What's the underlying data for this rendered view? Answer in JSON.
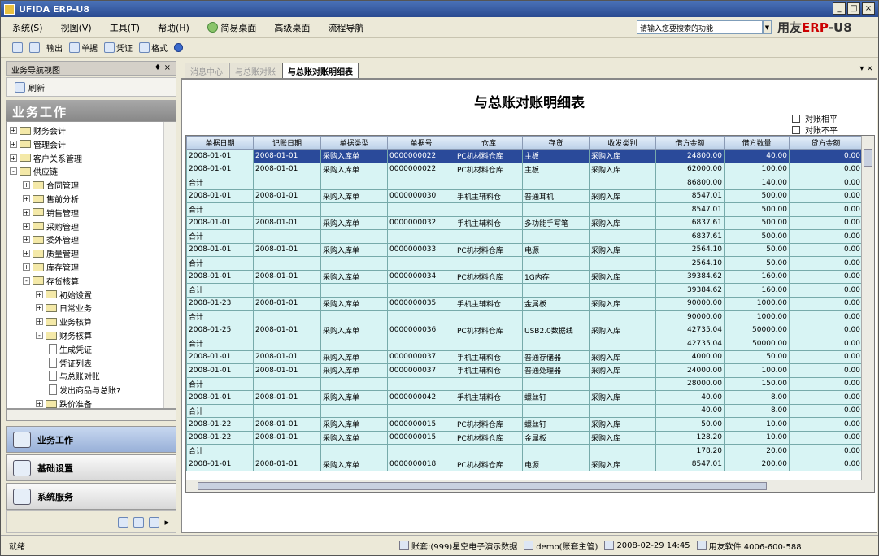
{
  "window": {
    "title": "UFIDA ERP-U8",
    "controls": [
      "_",
      "□",
      "×"
    ]
  },
  "menu": [
    "系统(S)",
    "视图(V)",
    "工具(T)",
    "帮助(H)",
    "简易桌面",
    "高级桌面",
    "流程导航"
  ],
  "search": {
    "placeholder": "请输入您要搜索的功能"
  },
  "brand": {
    "prefix": "用友",
    "erp": "ERP",
    "suffix": "-U8"
  },
  "toolbar": [
    "",
    "",
    "输出",
    "单据",
    "凭证",
    "格式",
    ""
  ],
  "nav": {
    "header": "业务导航视图",
    "pin": "♦ ×",
    "refresh": "刷新",
    "section": "业务工作",
    "tree": [
      {
        "label": "财务会计",
        "level": 0,
        "state": "+",
        "kind": "folder"
      },
      {
        "label": "管理会计",
        "level": 0,
        "state": "+",
        "kind": "folder"
      },
      {
        "label": "客户关系管理",
        "level": 0,
        "state": "+",
        "kind": "folder"
      },
      {
        "label": "供应链",
        "level": 0,
        "state": "-",
        "kind": "folder"
      },
      {
        "label": "合同管理",
        "level": 1,
        "state": "+",
        "kind": "folder"
      },
      {
        "label": "售前分析",
        "level": 1,
        "state": "+",
        "kind": "folder"
      },
      {
        "label": "销售管理",
        "level": 1,
        "state": "+",
        "kind": "folder"
      },
      {
        "label": "采购管理",
        "level": 1,
        "state": "+",
        "kind": "folder"
      },
      {
        "label": "委外管理",
        "level": 1,
        "state": "+",
        "kind": "folder"
      },
      {
        "label": "质量管理",
        "level": 1,
        "state": "+",
        "kind": "folder"
      },
      {
        "label": "库存管理",
        "level": 1,
        "state": "+",
        "kind": "folder"
      },
      {
        "label": "存货核算",
        "level": 1,
        "state": "-",
        "kind": "folder"
      },
      {
        "label": "初始设置",
        "level": 2,
        "state": "+",
        "kind": "folder"
      },
      {
        "label": "日常业务",
        "level": 2,
        "state": "+",
        "kind": "folder"
      },
      {
        "label": "业务核算",
        "level": 2,
        "state": "+",
        "kind": "folder"
      },
      {
        "label": "财务核算",
        "level": 2,
        "state": "-",
        "kind": "folder"
      },
      {
        "label": "生成凭证",
        "level": 3,
        "state": "",
        "kind": "doc"
      },
      {
        "label": "凭证列表",
        "level": 3,
        "state": "",
        "kind": "doc"
      },
      {
        "label": "与总账对账",
        "level": 3,
        "state": "",
        "kind": "doc"
      },
      {
        "label": "发出商品与总账?",
        "level": 3,
        "state": "",
        "kind": "doc"
      },
      {
        "label": "跌价准备",
        "level": 2,
        "state": "+",
        "kind": "folder"
      }
    ],
    "buttons": [
      "业务工作",
      "基础设置",
      "系统服务"
    ]
  },
  "tabs": [
    "消息中心",
    "与总账对账",
    "与总账对账明细表"
  ],
  "report": {
    "title": "与总账对账明细表",
    "checks": [
      "对账相平",
      "对账不平"
    ],
    "columns": [
      "单据日期",
      "记账日期",
      "单据类型",
      "单据号",
      "仓库",
      "存货",
      "收发类别",
      "借方金额",
      "借方数量",
      "贷方金额"
    ],
    "rows": [
      [
        "2008-01-01",
        "2008-01-01",
        "采购入库单",
        "0000000022",
        "PC机材料仓库",
        "主板",
        "采购入库",
        "24800.00",
        "40.00",
        "0.00"
      ],
      [
        "2008-01-01",
        "2008-01-01",
        "采购入库单",
        "0000000022",
        "PC机材料仓库",
        "主板",
        "采购入库",
        "62000.00",
        "100.00",
        "0.00"
      ],
      [
        "合计",
        "",
        "",
        "",
        "",
        "",
        "",
        "86800.00",
        "140.00",
        "0.00"
      ],
      [
        "2008-01-01",
        "2008-01-01",
        "采购入库单",
        "0000000030",
        "手机主辅料仓",
        "普通耳机",
        "采购入库",
        "8547.01",
        "500.00",
        "0.00"
      ],
      [
        "合计",
        "",
        "",
        "",
        "",
        "",
        "",
        "8547.01",
        "500.00",
        "0.00"
      ],
      [
        "2008-01-01",
        "2008-01-01",
        "采购入库单",
        "0000000032",
        "手机主辅料仓",
        "多功能手写笔",
        "采购入库",
        "6837.61",
        "500.00",
        "0.00"
      ],
      [
        "合计",
        "",
        "",
        "",
        "",
        "",
        "",
        "6837.61",
        "500.00",
        "0.00"
      ],
      [
        "2008-01-01",
        "2008-01-01",
        "采购入库单",
        "0000000033",
        "PC机材料仓库",
        "电源",
        "采购入库",
        "2564.10",
        "50.00",
        "0.00"
      ],
      [
        "合计",
        "",
        "",
        "",
        "",
        "",
        "",
        "2564.10",
        "50.00",
        "0.00"
      ],
      [
        "2008-01-01",
        "2008-01-01",
        "采购入库单",
        "0000000034",
        "PC机材料仓库",
        "1G内存",
        "采购入库",
        "39384.62",
        "160.00",
        "0.00"
      ],
      [
        "合计",
        "",
        "",
        "",
        "",
        "",
        "",
        "39384.62",
        "160.00",
        "0.00"
      ],
      [
        "2008-01-23",
        "2008-01-01",
        "采购入库单",
        "0000000035",
        "手机主辅料仓",
        "金属板",
        "采购入库",
        "90000.00",
        "1000.00",
        "0.00"
      ],
      [
        "合计",
        "",
        "",
        "",
        "",
        "",
        "",
        "90000.00",
        "1000.00",
        "0.00"
      ],
      [
        "2008-01-25",
        "2008-01-01",
        "采购入库单",
        "0000000036",
        "PC机材料仓库",
        "USB2.0数据线",
        "采购入库",
        "42735.04",
        "50000.00",
        "0.00"
      ],
      [
        "合计",
        "",
        "",
        "",
        "",
        "",
        "",
        "42735.04",
        "50000.00",
        "0.00"
      ],
      [
        "2008-01-01",
        "2008-01-01",
        "采购入库单",
        "0000000037",
        "手机主辅料仓",
        "普通存储器",
        "采购入库",
        "4000.00",
        "50.00",
        "0.00"
      ],
      [
        "2008-01-01",
        "2008-01-01",
        "采购入库单",
        "0000000037",
        "手机主辅料仓",
        "普通处理器",
        "采购入库",
        "24000.00",
        "100.00",
        "0.00"
      ],
      [
        "合计",
        "",
        "",
        "",
        "",
        "",
        "",
        "28000.00",
        "150.00",
        "0.00"
      ],
      [
        "2008-01-01",
        "2008-01-01",
        "采购入库单",
        "0000000042",
        "手机主辅料仓",
        "螺丝钉",
        "采购入库",
        "40.00",
        "8.00",
        "0.00"
      ],
      [
        "合计",
        "",
        "",
        "",
        "",
        "",
        "",
        "40.00",
        "8.00",
        "0.00"
      ],
      [
        "2008-01-22",
        "2008-01-01",
        "采购入库单",
        "0000000015",
        "PC机材料仓库",
        "螺丝钉",
        "采购入库",
        "50.00",
        "10.00",
        "0.00"
      ],
      [
        "2008-01-22",
        "2008-01-01",
        "采购入库单",
        "0000000015",
        "PC机材料仓库",
        "金属板",
        "采购入库",
        "128.20",
        "10.00",
        "0.00"
      ],
      [
        "合计",
        "",
        "",
        "",
        "",
        "",
        "",
        "178.20",
        "20.00",
        "0.00"
      ],
      [
        "2008-01-01",
        "2008-01-01",
        "采购入库单",
        "0000000018",
        "PC机材料仓库",
        "电源",
        "采购入库",
        "8547.01",
        "200.00",
        "0.00"
      ]
    ]
  },
  "status": {
    "ready": "就绪",
    "account": "账套:(999)星空电子演示数据",
    "user": "demo(账套主管)",
    "date": "2008-02-29 14:45",
    "company": "用友软件 4006-600-588"
  }
}
